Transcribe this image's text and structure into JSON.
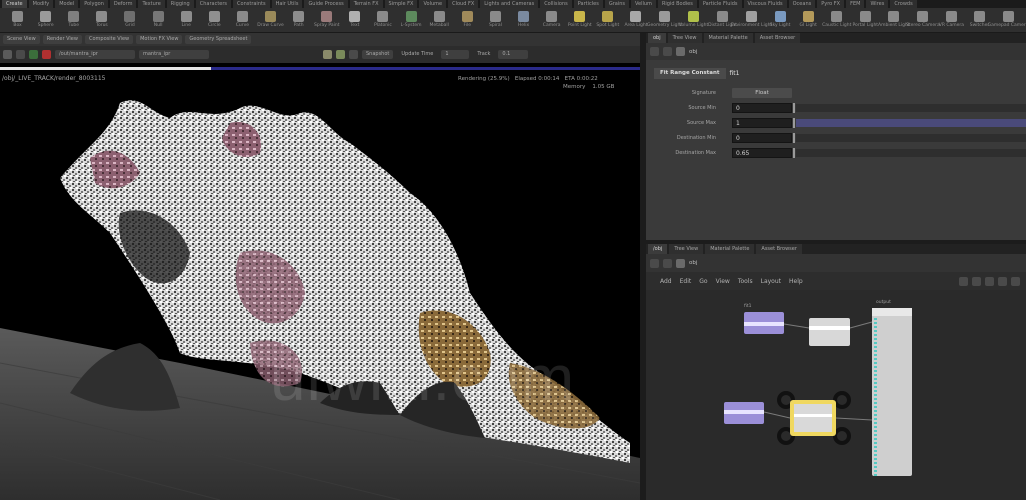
{
  "shelf": {
    "tabs": [
      "Create",
      "Modify",
      "Model",
      "Polygon",
      "Deform",
      "Texture",
      "Rigging",
      "Characters",
      "Constraints",
      "Hair Utils",
      "Guide Process",
      "Terrain FX",
      "Simple FX",
      "Volume",
      "Cloud FX",
      "Lights and Cameras",
      "Collisions",
      "Particles",
      "Grains",
      "Vellum",
      "Rigid Bodies",
      "Particle Fluids",
      "Viscous Fluids",
      "Oceans",
      "Pyro FX",
      "FEM",
      "Wires",
      "Crowds"
    ],
    "active_tab_index": 0,
    "tools": [
      {
        "label": "Box",
        "color": "#8a8a8a"
      },
      {
        "label": "Sphere",
        "color": "#9a9a9a"
      },
      {
        "label": "Tube",
        "color": "#7f7f7f"
      },
      {
        "label": "Torus",
        "color": "#8c8c8c"
      },
      {
        "label": "Grid",
        "color": "#6f6f6f"
      },
      {
        "label": "Null",
        "color": "#777"
      },
      {
        "label": "Line",
        "color": "#8d8d8d"
      },
      {
        "label": "Circle",
        "color": "#909090"
      },
      {
        "label": "Curve",
        "color": "#8a8a8a"
      },
      {
        "label": "Draw Curve",
        "color": "#9a8a5a"
      },
      {
        "label": "Path",
        "color": "#8c8c8c"
      },
      {
        "label": "Spray Paint",
        "color": "#9a7a7a"
      },
      {
        "label": "Text",
        "color": "#b0b0b0"
      },
      {
        "label": "Platonic",
        "color": "#8a8a8a"
      },
      {
        "label": "L-System",
        "color": "#5d8a5d"
      },
      {
        "label": "Metaball",
        "color": "#8a8a8a"
      },
      {
        "label": "File",
        "color": "#a08a5a"
      },
      {
        "label": "Spiral",
        "color": "#8a8a8a"
      },
      {
        "label": "Helix",
        "color": "#7a8aa0"
      },
      {
        "label": "Camera",
        "color": "#8a8a8a"
      },
      {
        "label": "Point Light",
        "color": "#c9b64a"
      },
      {
        "label": "Spot Light",
        "color": "#b8a44a"
      },
      {
        "label": "Area Light",
        "color": "#a8a8a8"
      },
      {
        "label": "Geometry Light",
        "color": "#9a9a9a"
      },
      {
        "label": "Volume Light",
        "color": "#b0c04a"
      },
      {
        "label": "Distant Light",
        "color": "#8a8a8a"
      },
      {
        "label": "Environment Light",
        "color": "#a0a0a0"
      },
      {
        "label": "Sky Light",
        "color": "#7a9ac0"
      },
      {
        "label": "GI Light",
        "color": "#b49a5a"
      },
      {
        "label": "Caustic Light",
        "color": "#8a8a8a"
      },
      {
        "label": "Portal Light",
        "color": "#8a8a8a"
      },
      {
        "label": "Ambient Light",
        "color": "#8a8a8a"
      },
      {
        "label": "Stereo Camera",
        "color": "#8a8a8a"
      },
      {
        "label": "VR Camera",
        "color": "#8a8a8a"
      },
      {
        "label": "Switcher",
        "color": "#8a8a8a"
      },
      {
        "label": "Gamepad Camera",
        "color": "#8a8a8a"
      }
    ]
  },
  "viewer": {
    "tabs": [
      "Scene View",
      "Render View",
      "Composite View",
      "Motion FX View",
      "Geometry Spreadsheet"
    ],
    "camera": "/out/mantra_ipr",
    "render_name": "mantra_ipr",
    "snapshot_label": "Snapshot",
    "update_time_label": "Update Time",
    "update_time_value": "1",
    "track_label": "Track",
    "track_value": "0.1",
    "progress": 0.33,
    "render_path": "/obj/_LIVE_TRACK/render_8003115",
    "status": {
      "rendering": "Rendering (25.9%)",
      "elapsed": "Elapsed 0:00:14",
      "eta": "ETA 0:00:22",
      "memory_label": "Memory",
      "memory_value": "1.05 GB"
    },
    "watermark": "uiwiki.com"
  },
  "params": {
    "tabs": [
      "obj",
      "Tree View",
      "Material Palette",
      "Asset Browser"
    ],
    "path": "obj",
    "node_type": "Fit Range Constant",
    "node_name": "fit1",
    "rows": [
      {
        "label": "Signature",
        "type": "dropdown",
        "value": "Float"
      },
      {
        "label": "Source Min",
        "type": "slider",
        "value": "0",
        "fraction": 0
      },
      {
        "label": "Source Max",
        "type": "slider",
        "value": "1",
        "fraction": 1
      },
      {
        "label": "Destination Min",
        "type": "slider",
        "value": "0",
        "fraction": 0
      },
      {
        "label": "Destination Max",
        "type": "slider",
        "value": "0.65",
        "fraction": 0
      }
    ]
  },
  "network": {
    "tabs": [
      "/obj",
      "Tree View",
      "Material Palette",
      "Asset Browser"
    ],
    "path": "obj",
    "menu": [
      "Add",
      "Edit",
      "Go",
      "View",
      "Tools",
      "Layout",
      "Help"
    ],
    "colors": {
      "purple": "#9b8fd8",
      "white": "#d8d8d8",
      "yellow": "#f0d860",
      "wire": "#7a7a7a",
      "ports": "#55c9c2"
    }
  }
}
